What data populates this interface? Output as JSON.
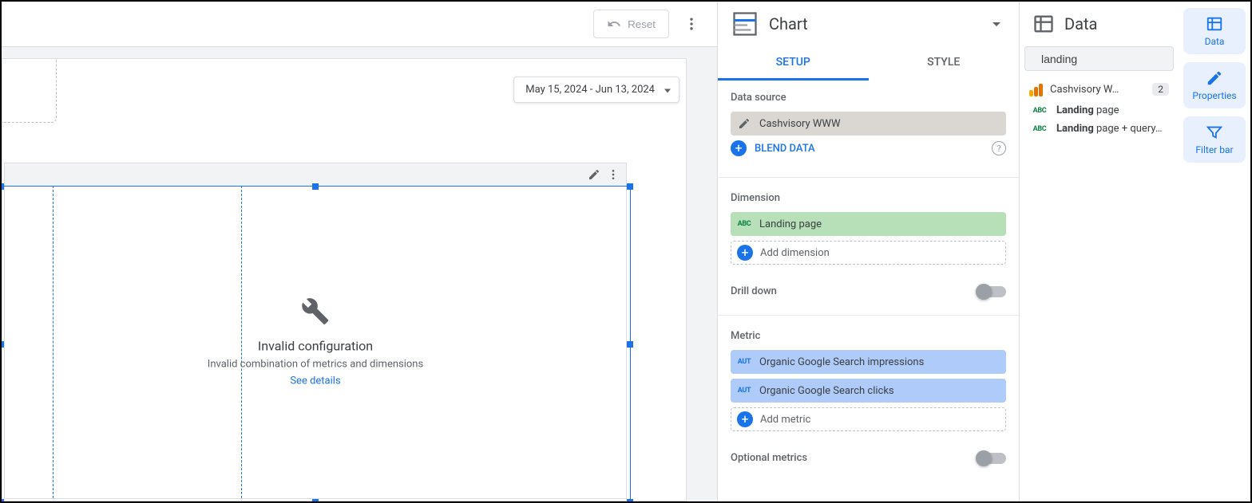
{
  "toolbar": {
    "reset": "Reset"
  },
  "canvas": {
    "date_range": "May 15, 2024 - Jun 13, 2024",
    "error_title": "Invalid configuration",
    "error_message": "Invalid combination of metrics and dimensions",
    "error_link": "See details"
  },
  "chart_panel": {
    "title": "Chart",
    "tabs": {
      "setup": "SETUP",
      "style": "STYLE"
    },
    "data_source_label": "Data source",
    "data_source_name": "Cashvisory WWW",
    "blend_data": "BLEND DATA",
    "dimension_label": "Dimension",
    "dimension_value": "Landing page",
    "add_dimension": "Add dimension",
    "drill_down": "Drill down",
    "metric_label": "Metric",
    "metrics": [
      "Organic Google Search impressions",
      "Organic Google Search clicks"
    ],
    "add_metric": "Add metric",
    "optional_metrics": "Optional metrics"
  },
  "data_panel": {
    "title": "Data",
    "search_value": "landing",
    "datasource_name": "Cashvisory W…",
    "datasource_count": "2",
    "fields": [
      {
        "prefix": "Landing",
        "suffix": " page"
      },
      {
        "prefix": "Landing",
        "suffix": " page + query…"
      }
    ]
  },
  "rail": {
    "data": "Data",
    "properties": "Properties",
    "filterbar": "Filter bar"
  }
}
